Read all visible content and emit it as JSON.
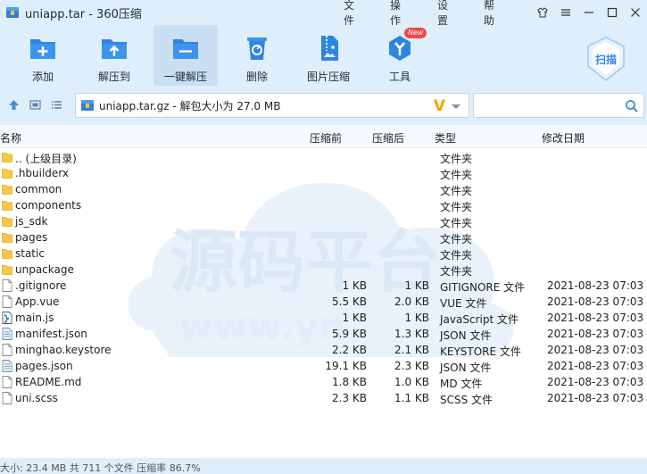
{
  "window": {
    "title": "uniapp.tar - 360压缩",
    "menu": [
      "文件",
      "操作",
      "设置",
      "帮助"
    ]
  },
  "toolbar": {
    "buttons": [
      {
        "label": "添加",
        "icon": "add-folder-icon"
      },
      {
        "label": "解压到",
        "icon": "extract-to-icon"
      },
      {
        "label": "一键解压",
        "icon": "one-click-extract-icon"
      },
      {
        "label": "删除",
        "icon": "recycle-bin-icon"
      },
      {
        "label": "图片压缩",
        "icon": "image-compress-icon"
      },
      {
        "label": "工具",
        "icon": "tools-icon",
        "badge": "New"
      }
    ],
    "scan_label": "扫描"
  },
  "address": {
    "path": "uniapp.tar.gz - 解包大小为 27.0 MB",
    "search_placeholder": ""
  },
  "columns": {
    "name": "名称",
    "before": "压缩前",
    "after": "压缩后",
    "type": "类型",
    "date": "修改日期"
  },
  "files": [
    {
      "name": ".. (上级目录)",
      "before": "",
      "after": "",
      "type": "文件夹",
      "date": "",
      "icon": "folder"
    },
    {
      "name": ".hbuilderx",
      "before": "",
      "after": "",
      "type": "文件夹",
      "date": "",
      "icon": "folder"
    },
    {
      "name": "common",
      "before": "",
      "after": "",
      "type": "文件夹",
      "date": "",
      "icon": "folder"
    },
    {
      "name": "components",
      "before": "",
      "after": "",
      "type": "文件夹",
      "date": "",
      "icon": "folder"
    },
    {
      "name": "js_sdk",
      "before": "",
      "after": "",
      "type": "文件夹",
      "date": "",
      "icon": "folder"
    },
    {
      "name": "pages",
      "before": "",
      "after": "",
      "type": "文件夹",
      "date": "",
      "icon": "folder"
    },
    {
      "name": "static",
      "before": "",
      "after": "",
      "type": "文件夹",
      "date": "",
      "icon": "folder"
    },
    {
      "name": "unpackage",
      "before": "",
      "after": "",
      "type": "文件夹",
      "date": "",
      "icon": "folder"
    },
    {
      "name": ".gitignore",
      "before": "1 KB",
      "after": "1 KB",
      "type": "GITIGNORE 文件",
      "date": "2021-08-23 07:03",
      "icon": "file"
    },
    {
      "name": "App.vue",
      "before": "5.5 KB",
      "after": "2.0 KB",
      "type": "VUE 文件",
      "date": "2021-08-23 07:03",
      "icon": "file"
    },
    {
      "name": "main.js",
      "before": "1 KB",
      "after": "1 KB",
      "type": "JavaScript 文件",
      "date": "2021-08-23 07:03",
      "icon": "js"
    },
    {
      "name": "manifest.json",
      "before": "5.9 KB",
      "after": "1.3 KB",
      "type": "JSON 文件",
      "date": "2021-08-23 07:03",
      "icon": "json"
    },
    {
      "name": "minghao.keystore",
      "before": "2.2 KB",
      "after": "2.1 KB",
      "type": "KEYSTORE 文件",
      "date": "2021-08-23 07:03",
      "icon": "file"
    },
    {
      "name": "pages.json",
      "before": "19.1 KB",
      "after": "2.3 KB",
      "type": "JSON 文件",
      "date": "2021-08-23 07:03",
      "icon": "json"
    },
    {
      "name": "README.md",
      "before": "1.8 KB",
      "after": "1.0 KB",
      "type": "MD 文件",
      "date": "2021-08-23 07:03",
      "icon": "file"
    },
    {
      "name": "uni.scss",
      "before": "2.3 KB",
      "after": "1.1 KB",
      "type": "SCSS 文件",
      "date": "2021-08-23 07:03",
      "icon": "file"
    }
  ],
  "watermark": {
    "brand": "源码平台",
    "url": "www.yn"
  },
  "status": {
    "text": "大小: 23.4 MB 共 711 个文件 压缩率 86.7%"
  },
  "colors": {
    "chrome": "#dfeefb",
    "accent": "#2e86e6",
    "folder": "#f7c948"
  }
}
